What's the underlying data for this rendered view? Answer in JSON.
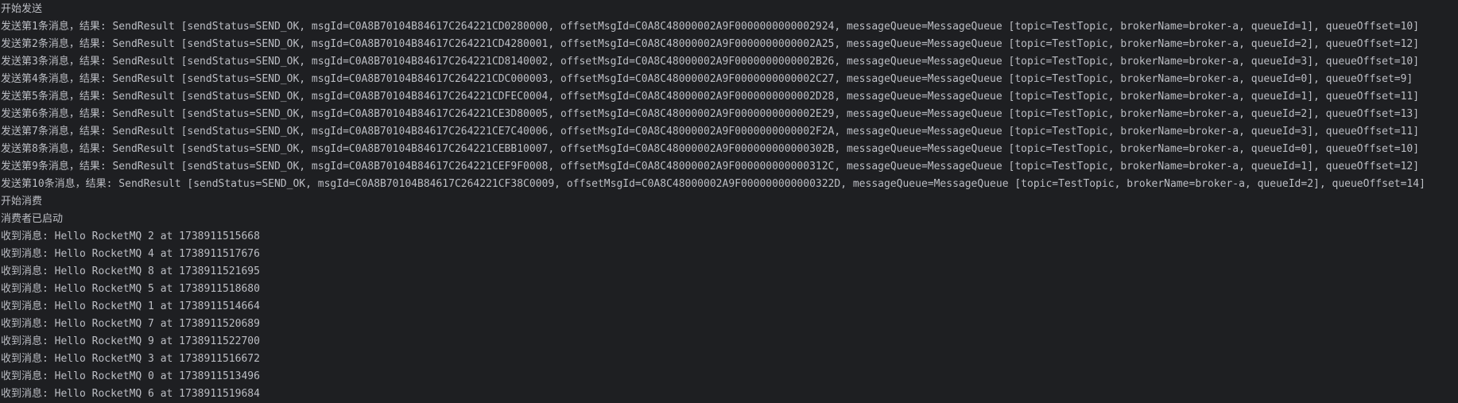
{
  "console": {
    "lines": [
      "开始发送",
      "发送第1条消息，结果: SendResult [sendStatus=SEND_OK, msgId=C0A8B70104B84617C264221CD0280000, offsetMsgId=C0A8C48000002A9F0000000000002924, messageQueue=MessageQueue [topic=TestTopic, brokerName=broker-a, queueId=1], queueOffset=10]",
      "发送第2条消息，结果: SendResult [sendStatus=SEND_OK, msgId=C0A8B70104B84617C264221CD4280001, offsetMsgId=C0A8C48000002A9F0000000000002A25, messageQueue=MessageQueue [topic=TestTopic, brokerName=broker-a, queueId=2], queueOffset=12]",
      "发送第3条消息，结果: SendResult [sendStatus=SEND_OK, msgId=C0A8B70104B84617C264221CD8140002, offsetMsgId=C0A8C48000002A9F0000000000002B26, messageQueue=MessageQueue [topic=TestTopic, brokerName=broker-a, queueId=3], queueOffset=10]",
      "发送第4条消息，结果: SendResult [sendStatus=SEND_OK, msgId=C0A8B70104B84617C264221CDC000003, offsetMsgId=C0A8C48000002A9F0000000000002C27, messageQueue=MessageQueue [topic=TestTopic, brokerName=broker-a, queueId=0], queueOffset=9]",
      "发送第5条消息，结果: SendResult [sendStatus=SEND_OK, msgId=C0A8B70104B84617C264221CDFEC0004, offsetMsgId=C0A8C48000002A9F0000000000002D28, messageQueue=MessageQueue [topic=TestTopic, brokerName=broker-a, queueId=1], queueOffset=11]",
      "发送第6条消息，结果: SendResult [sendStatus=SEND_OK, msgId=C0A8B70104B84617C264221CE3D80005, offsetMsgId=C0A8C48000002A9F0000000000002E29, messageQueue=MessageQueue [topic=TestTopic, brokerName=broker-a, queueId=2], queueOffset=13]",
      "发送第7条消息，结果: SendResult [sendStatus=SEND_OK, msgId=C0A8B70104B84617C264221CE7C40006, offsetMsgId=C0A8C48000002A9F0000000000002F2A, messageQueue=MessageQueue [topic=TestTopic, brokerName=broker-a, queueId=3], queueOffset=11]",
      "发送第8条消息，结果: SendResult [sendStatus=SEND_OK, msgId=C0A8B70104B84617C264221CEBB10007, offsetMsgId=C0A8C48000002A9F000000000000302B, messageQueue=MessageQueue [topic=TestTopic, brokerName=broker-a, queueId=0], queueOffset=10]",
      "发送第9条消息，结果: SendResult [sendStatus=SEND_OK, msgId=C0A8B70104B84617C264221CEF9F0008, offsetMsgId=C0A8C48000002A9F000000000000312C, messageQueue=MessageQueue [topic=TestTopic, brokerName=broker-a, queueId=1], queueOffset=12]",
      "发送第10条消息，结果: SendResult [sendStatus=SEND_OK, msgId=C0A8B70104B84617C264221CF38C0009, offsetMsgId=C0A8C48000002A9F000000000000322D, messageQueue=MessageQueue [topic=TestTopic, brokerName=broker-a, queueId=2], queueOffset=14]",
      "开始消费",
      "消费者已启动",
      "收到消息: Hello RocketMQ 2 at 1738911515668",
      "收到消息: Hello RocketMQ 4 at 1738911517676",
      "收到消息: Hello RocketMQ 8 at 1738911521695",
      "收到消息: Hello RocketMQ 5 at 1738911518680",
      "收到消息: Hello RocketMQ 1 at 1738911514664",
      "收到消息: Hello RocketMQ 7 at 1738911520689",
      "收到消息: Hello RocketMQ 9 at 1738911522700",
      "收到消息: Hello RocketMQ 3 at 1738911516672",
      "收到消息: Hello RocketMQ 0 at 1738911513496",
      "收到消息: Hello RocketMQ 6 at 1738911519684"
    ]
  },
  "colors": {
    "background": "#1e1f22",
    "text": "#bcbec4"
  }
}
